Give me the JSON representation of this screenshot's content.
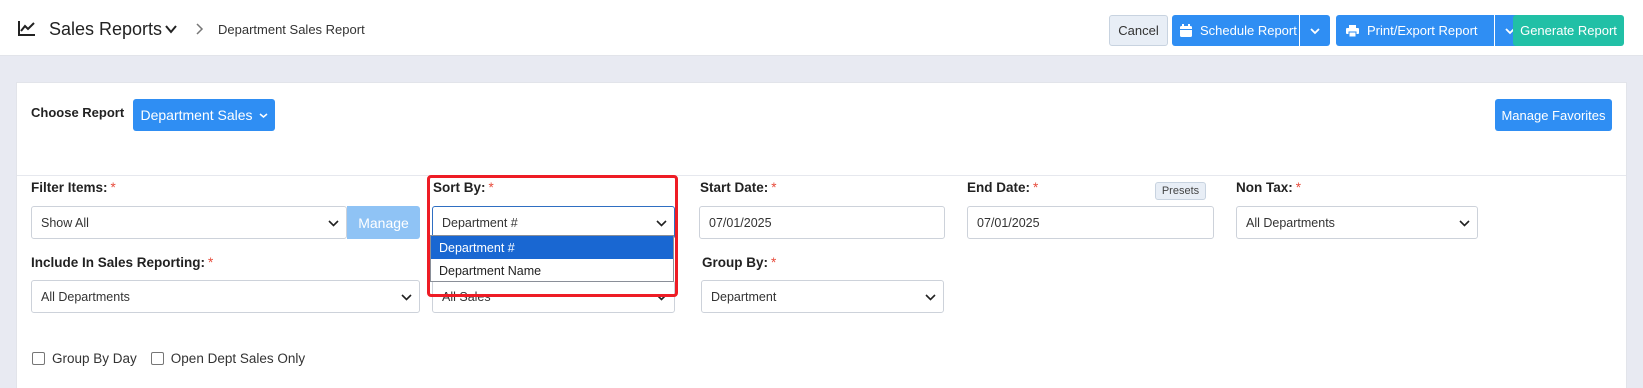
{
  "header": {
    "app_title": "Sales Reports",
    "breadcrumb": "Department Sales Report",
    "cancel_label": "Cancel",
    "schedule_label": "Schedule Report",
    "print_label": "Print/Export Report",
    "generate_label": "Generate Report"
  },
  "report": {
    "choose_label": "Choose Report",
    "selected_report": "Department Sales",
    "manage_favorites_label": "Manage Favorites"
  },
  "filters": {
    "filter_items": {
      "label": "Filter Items:",
      "value": "Show All",
      "manage_label": "Manage"
    },
    "sort_by": {
      "label": "Sort By:",
      "value": "Department #",
      "options": [
        "Department #",
        "Department Name"
      ],
      "selected_index": 0
    },
    "start_date": {
      "label": "Start Date:",
      "value": "07/01/2025"
    },
    "end_date": {
      "label": "End Date:",
      "value": "07/01/2025",
      "presets_label": "Presets"
    },
    "non_tax": {
      "label": "Non Tax:",
      "value": "All Departments"
    },
    "include_in_sales": {
      "label": "Include In Sales Reporting:",
      "value": "All Departments"
    },
    "sales_type": {
      "value": "All Sales"
    },
    "group_by": {
      "label": "Group By:",
      "value": "Department"
    },
    "required_marker": "*"
  },
  "checkboxes": {
    "group_by_day": {
      "label": "Group By Day",
      "checked": false
    },
    "open_dept_sales_only": {
      "label": "Open Dept Sales Only",
      "checked": false
    }
  },
  "colors": {
    "primary": "#2f8ef3",
    "success": "#21c0a6",
    "required": "#e74c3c",
    "highlight": "#ee1c25",
    "dropdown_selected": "#1967d2"
  }
}
